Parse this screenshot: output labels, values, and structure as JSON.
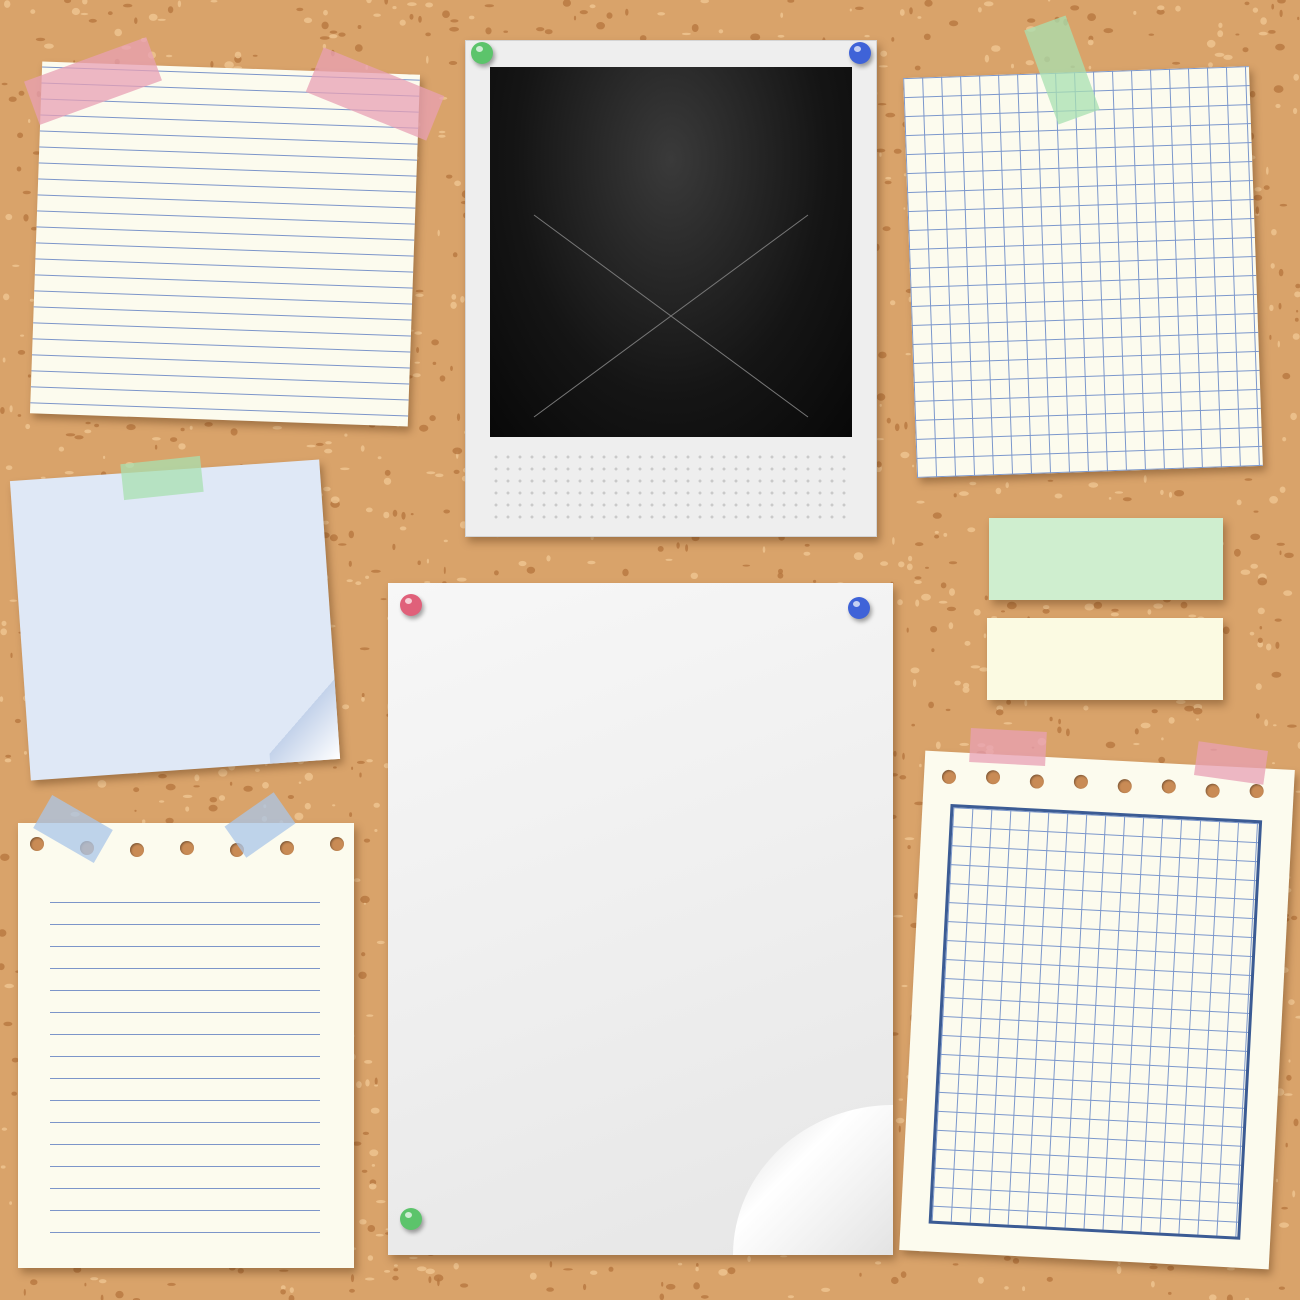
{
  "board": {
    "background_color": "#d9a36a",
    "speck_dark": "#b77740",
    "speck_light": "#efc592"
  },
  "colors": {
    "pin_green": "#5cc46b",
    "pin_blue": "#3f63d8",
    "pin_pink": "#e0607a",
    "tape_pink": "#e8a0b4",
    "tape_green": "#a8e0b0",
    "tape_blue": "#a9c6e8",
    "note_blue": "#dfe8f6",
    "note_green": "#cfeecf",
    "note_yellow": "#fbfae2",
    "paper_cream": "#fcfbee",
    "paper_white": "#f3f3f3",
    "photo_frame": "#eeeeee",
    "photo_black": "#111111",
    "grid_blue": "#3b5b94"
  },
  "icons": {
    "pin": "push-pin-icon",
    "tape": "adhesive-tape-icon",
    "curl": "page-curl-icon"
  }
}
